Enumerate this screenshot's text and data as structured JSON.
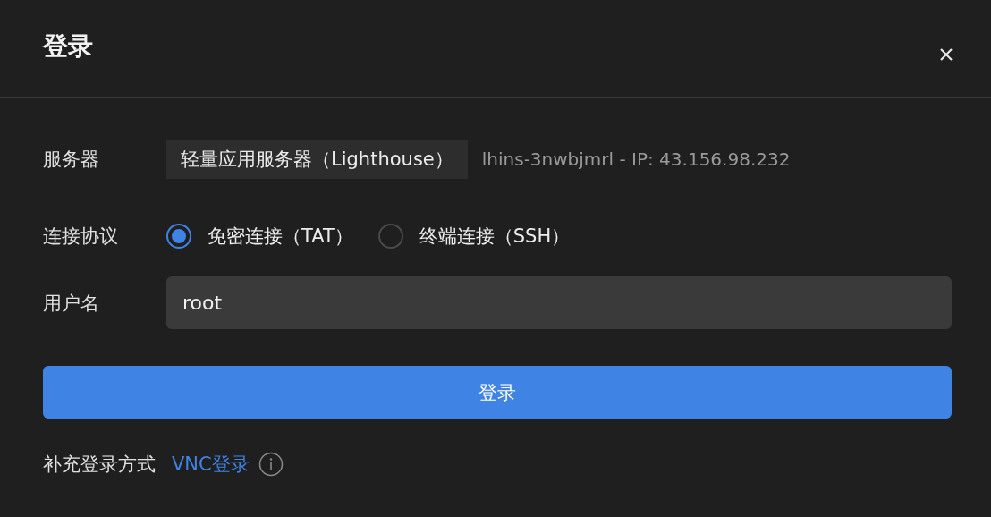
{
  "dialog": {
    "title": "登录"
  },
  "server": {
    "label": "服务器",
    "type": "轻量应用服务器（Lighthouse）",
    "detail": "lhins-3nwbjmrl - IP: 43.156.98.232"
  },
  "protocol": {
    "label": "连接协议",
    "options": [
      {
        "label": "免密连接（TAT）",
        "selected": true
      },
      {
        "label": "终端连接（SSH）",
        "selected": false
      }
    ]
  },
  "username": {
    "label": "用户名",
    "value": "root"
  },
  "submit_button": "登录",
  "extra": {
    "label": "补充登录方式",
    "link": "VNC登录"
  }
}
